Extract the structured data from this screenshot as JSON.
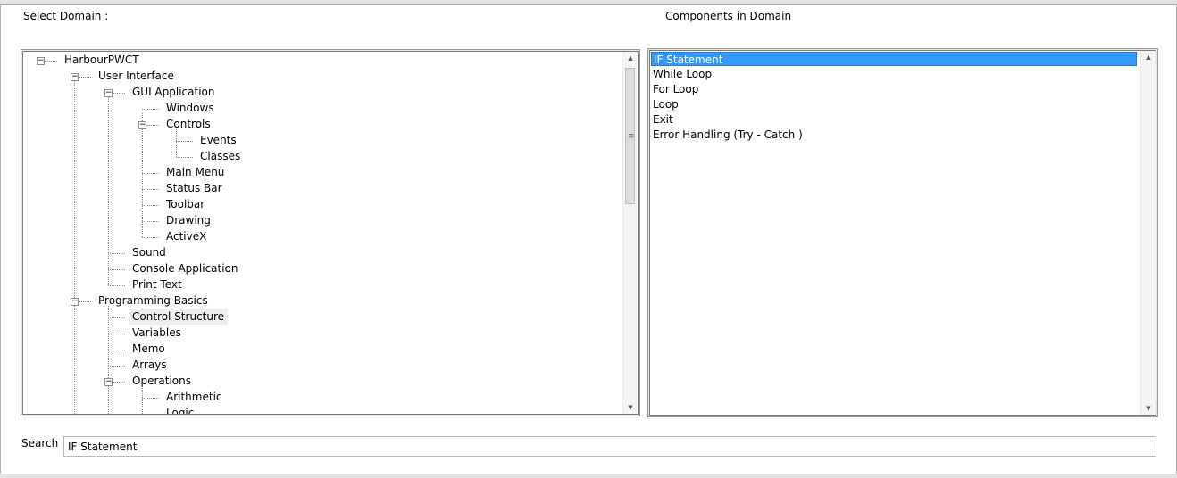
{
  "labels": {
    "select_domain": "Select Domain :",
    "components_in_domain": "Components in Domain",
    "search": "Search"
  },
  "tree": {
    "nodes": [
      {
        "label": "HarbourPWCT",
        "expanded": true
      },
      {
        "label": "User Interface",
        "expanded": true
      },
      {
        "label": "GUI Application",
        "expanded": true
      },
      {
        "label": "Windows"
      },
      {
        "label": "Controls",
        "expanded": true
      },
      {
        "label": "Events"
      },
      {
        "label": "Classes"
      },
      {
        "label": "Main Menu"
      },
      {
        "label": "Status Bar"
      },
      {
        "label": "Toolbar"
      },
      {
        "label": "Drawing"
      },
      {
        "label": "ActiveX"
      },
      {
        "label": "Sound"
      },
      {
        "label": "Console Application"
      },
      {
        "label": "Print Text"
      },
      {
        "label": "Programming Basics",
        "expanded": true
      },
      {
        "label": "Control Structure",
        "selected": true
      },
      {
        "label": "Variables"
      },
      {
        "label": "Memo"
      },
      {
        "label": "Arrays"
      },
      {
        "label": "Operations",
        "expanded": true
      },
      {
        "label": "Arithmetic"
      },
      {
        "label": "Logic"
      }
    ]
  },
  "components": {
    "items": [
      "IF Statement",
      "While Loop",
      "For Loop",
      "Loop",
      "Exit",
      "Error Handling (Try - Catch )"
    ],
    "selected": "IF Statement"
  },
  "search": {
    "value": "IF Statement"
  },
  "colors": {
    "selection": "#3399ff",
    "tree_selection": "#eeeeee"
  }
}
